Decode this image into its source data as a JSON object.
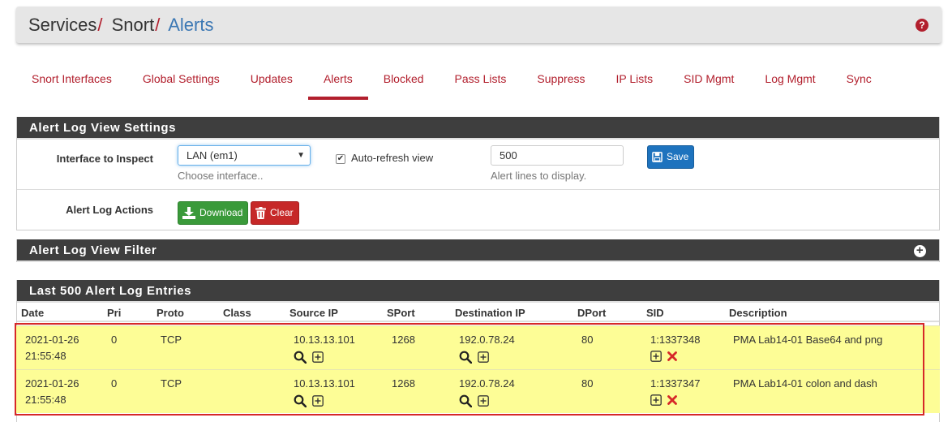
{
  "breadcrumb": {
    "items": [
      "Services",
      "Snort"
    ],
    "separator": "/",
    "active": "Alerts"
  },
  "tabs": [
    {
      "label": "Snort Interfaces"
    },
    {
      "label": "Global Settings"
    },
    {
      "label": "Updates"
    },
    {
      "label": "Alerts",
      "active": true
    },
    {
      "label": "Blocked"
    },
    {
      "label": "Pass Lists"
    },
    {
      "label": "Suppress"
    },
    {
      "label": "IP Lists"
    },
    {
      "label": "SID Mgmt"
    },
    {
      "label": "Log Mgmt"
    },
    {
      "label": "Sync"
    }
  ],
  "settings": {
    "title": "Alert Log View Settings",
    "interface_label": "Interface to Inspect",
    "interface_value": "LAN (em1)",
    "interface_help": "Choose interface..",
    "autorefresh_label": "Auto-refresh view",
    "autorefresh_checked": true,
    "lines_value": "500",
    "lines_help": "Alert lines to display.",
    "save_label": "Save",
    "actions_label": "Alert Log Actions",
    "download_label": "Download",
    "clear_label": "Clear"
  },
  "filter": {
    "title": "Alert Log View Filter"
  },
  "entries": {
    "title": "Last 500 Alert Log Entries",
    "columns": [
      "Date",
      "Pri",
      "Proto",
      "Class",
      "Source IP",
      "SPort",
      "Destination IP",
      "DPort",
      "SID",
      "Description"
    ],
    "rows": [
      {
        "date": "2021-01-26",
        "time": "21:55:48",
        "pri": "0",
        "proto": "TCP",
        "class": "",
        "src": "10.13.13.101",
        "sport": "1268",
        "dst": "192.0.78.24",
        "dport": "80",
        "sid": "1:1337348",
        "desc": "PMA Lab14-01 Base64 and png"
      },
      {
        "date": "2021-01-26",
        "time": "21:55:48",
        "pri": "0",
        "proto": "TCP",
        "class": "",
        "src": "10.13.13.101",
        "sport": "1268",
        "dst": "192.0.78.24",
        "dport": "80",
        "sid": "1:1337347",
        "desc": "PMA Lab14-01 colon and dash"
      }
    ]
  },
  "colors": {
    "accent": "#b21f2d",
    "panel_header": "#3e3e3e",
    "row_highlight": "#fdfd96",
    "save": "#1e73be",
    "download": "#3a9a3a",
    "clear": "#c62828"
  }
}
